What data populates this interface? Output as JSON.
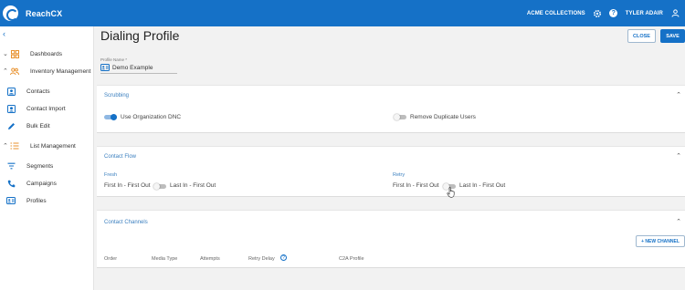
{
  "app": {
    "brand": "ReachCX"
  },
  "topbar": {
    "org": "ACME COLLECTIONS",
    "user": "TYLER ADAIR"
  },
  "sidebar": {
    "items": [
      {
        "label": "Dashboards",
        "section": true
      },
      {
        "label": "Inventory Management",
        "section": true
      },
      {
        "label": "Contacts"
      },
      {
        "label": "Contact Import"
      },
      {
        "label": "Bulk Edit"
      },
      {
        "label": "List Management",
        "section": true
      },
      {
        "label": "Segments"
      },
      {
        "label": "Campaigns"
      },
      {
        "label": "Profiles"
      }
    ]
  },
  "page": {
    "title": "Dialing Profile",
    "close_label": "CLOSE",
    "save_label": "SAVE",
    "profile_name_label": "Profile Name *",
    "profile_name_value": "Demo Example"
  },
  "scrubbing": {
    "title": "Scrubbing",
    "use_org_dnc": {
      "label": "Use Organization DNC",
      "on": true
    },
    "remove_duplicates": {
      "label": "Remove Duplicate Users",
      "on": false
    }
  },
  "contact_flow": {
    "title": "Contact Flow",
    "fresh": {
      "label": "Fresh",
      "left": "First In - First Out",
      "right": "Last In - First Out",
      "on": false
    },
    "retry": {
      "label": "Retry",
      "left": "First In - First Out",
      "right": "Last In - First Out",
      "on": false
    }
  },
  "contact_channels": {
    "title": "Contact Channels",
    "new_label": "+ NEW CHANNEL",
    "columns": [
      "Order",
      "Media Type",
      "Attempts",
      "Retry Delay",
      "C2A Profile"
    ]
  },
  "colors": {
    "primary": "#1571c7",
    "accent_orange": "#e8912d"
  }
}
